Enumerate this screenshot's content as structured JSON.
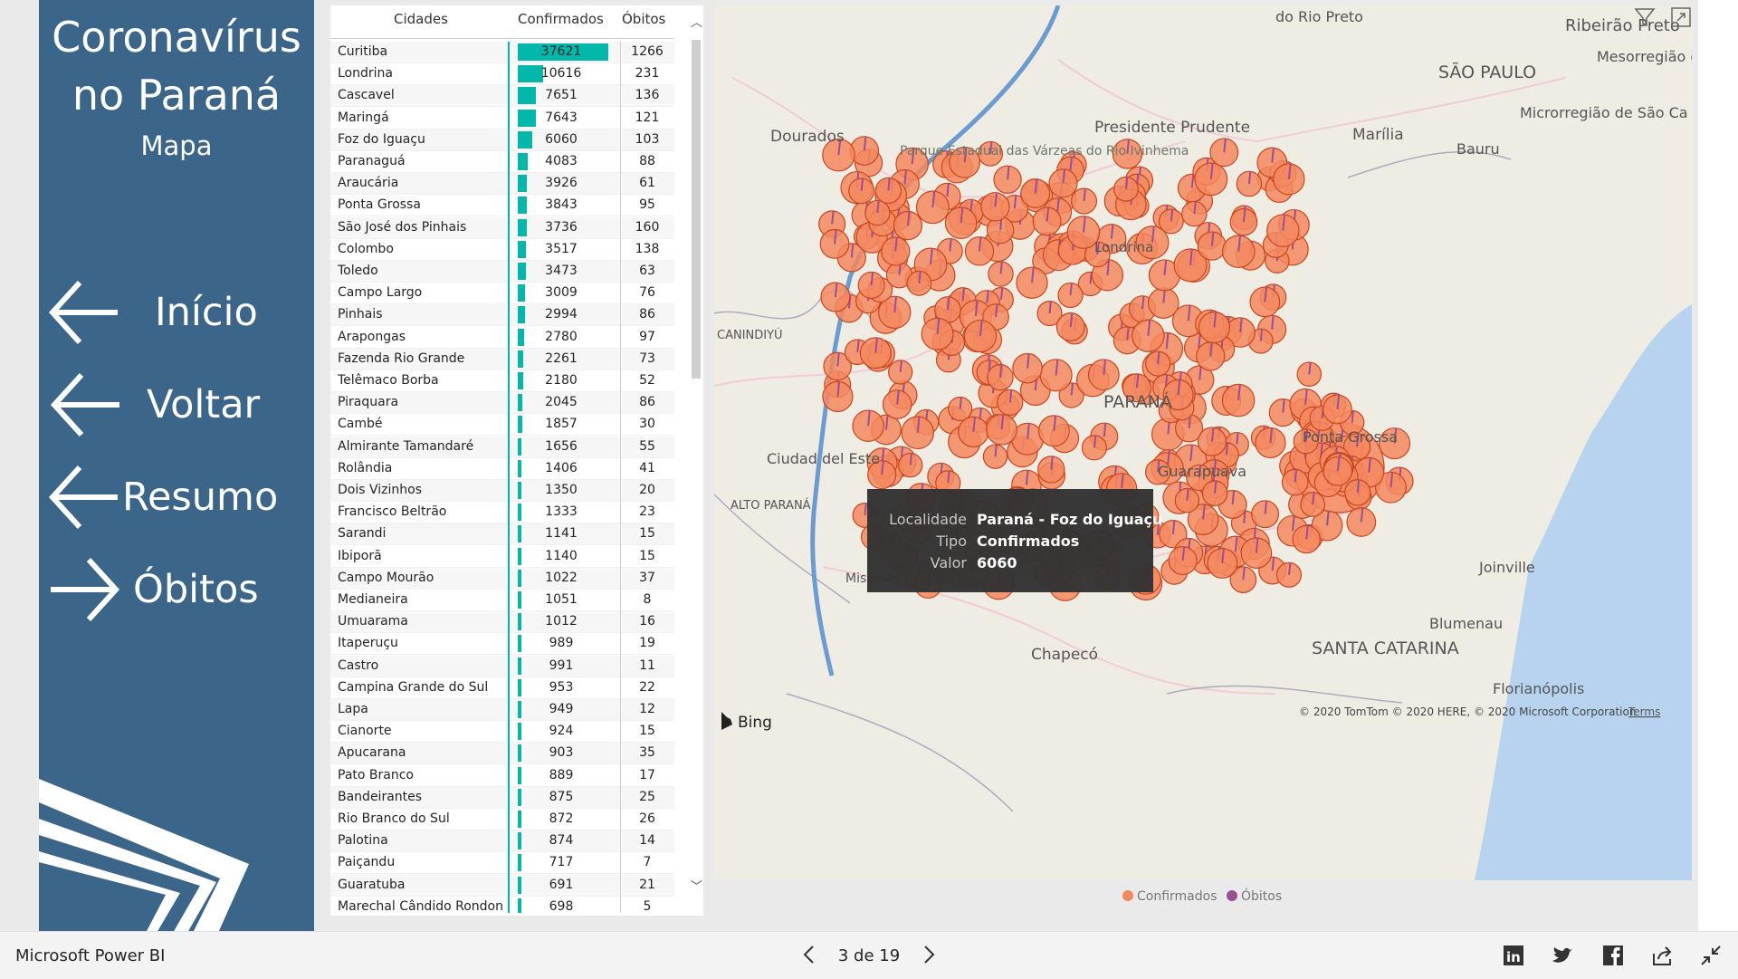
{
  "nav": {
    "title_line1": "Coronavírus",
    "title_line2": "no Paraná",
    "subtitle": "Mapa",
    "buttons": [
      {
        "label": "Início",
        "direction": "left"
      },
      {
        "label": "Voltar",
        "direction": "left"
      },
      {
        "label": "Resumo",
        "direction": "left"
      },
      {
        "label": "Óbitos",
        "direction": "right"
      }
    ]
  },
  "table": {
    "headers": {
      "city": "Cidades",
      "confirmed": "Confirmados",
      "deaths": "Óbitos"
    },
    "bar_color": "#01b8aa",
    "rows": [
      {
        "city": "Curitiba",
        "confirmed": "37621",
        "deaths": "1266"
      },
      {
        "city": "Londrina",
        "confirmed": "10616",
        "deaths": "231"
      },
      {
        "city": "Cascavel",
        "confirmed": "7651",
        "deaths": "136"
      },
      {
        "city": "Maringá",
        "confirmed": "7643",
        "deaths": "121"
      },
      {
        "city": "Foz do Iguaçu",
        "confirmed": "6060",
        "deaths": "103"
      },
      {
        "city": "Paranaguá",
        "confirmed": "4083",
        "deaths": "88"
      },
      {
        "city": "Araucária",
        "confirmed": "3926",
        "deaths": "61"
      },
      {
        "city": "Ponta Grossa",
        "confirmed": "3843",
        "deaths": "95"
      },
      {
        "city": "São José dos Pinhais",
        "confirmed": "3736",
        "deaths": "160"
      },
      {
        "city": "Colombo",
        "confirmed": "3517",
        "deaths": "138"
      },
      {
        "city": "Toledo",
        "confirmed": "3473",
        "deaths": "63"
      },
      {
        "city": "Campo Largo",
        "confirmed": "3009",
        "deaths": "76"
      },
      {
        "city": "Pinhais",
        "confirmed": "2994",
        "deaths": "86"
      },
      {
        "city": "Arapongas",
        "confirmed": "2780",
        "deaths": "97"
      },
      {
        "city": "Fazenda Rio Grande",
        "confirmed": "2261",
        "deaths": "73"
      },
      {
        "city": "Telêmaco Borba",
        "confirmed": "2180",
        "deaths": "52"
      },
      {
        "city": "Piraquara",
        "confirmed": "2045",
        "deaths": "86"
      },
      {
        "city": "Cambé",
        "confirmed": "1857",
        "deaths": "30"
      },
      {
        "city": "Almirante Tamandaré",
        "confirmed": "1656",
        "deaths": "55"
      },
      {
        "city": "Rolândia",
        "confirmed": "1406",
        "deaths": "41"
      },
      {
        "city": "Dois Vizinhos",
        "confirmed": "1350",
        "deaths": "20"
      },
      {
        "city": "Francisco Beltrão",
        "confirmed": "1333",
        "deaths": "23"
      },
      {
        "city": "Sarandi",
        "confirmed": "1141",
        "deaths": "15"
      },
      {
        "city": "Ibiporã",
        "confirmed": "1140",
        "deaths": "15"
      },
      {
        "city": "Campo Mourão",
        "confirmed": "1022",
        "deaths": "37"
      },
      {
        "city": "Medianeira",
        "confirmed": "1051",
        "deaths": "8"
      },
      {
        "city": "Umuarama",
        "confirmed": "1012",
        "deaths": "16"
      },
      {
        "city": "Itaperuçu",
        "confirmed": "989",
        "deaths": "19"
      },
      {
        "city": "Castro",
        "confirmed": "991",
        "deaths": "11"
      },
      {
        "city": "Campina Grande do Sul",
        "confirmed": "953",
        "deaths": "22"
      },
      {
        "city": "Lapa",
        "confirmed": "949",
        "deaths": "12"
      },
      {
        "city": "Cianorte",
        "confirmed": "924",
        "deaths": "15"
      },
      {
        "city": "Apucarana",
        "confirmed": "903",
        "deaths": "35"
      },
      {
        "city": "Pato Branco",
        "confirmed": "889",
        "deaths": "17"
      },
      {
        "city": "Bandeirantes",
        "confirmed": "875",
        "deaths": "25"
      },
      {
        "city": "Rio Branco do Sul",
        "confirmed": "872",
        "deaths": "26"
      },
      {
        "city": "Palotina",
        "confirmed": "874",
        "deaths": "14"
      },
      {
        "city": "Paiçandu",
        "confirmed": "717",
        "deaths": "7"
      },
      {
        "city": "Guaratuba",
        "confirmed": "691",
        "deaths": "21"
      },
      {
        "city": "Marechal Cândido Rondon",
        "confirmed": "698",
        "deaths": "5"
      }
    ]
  },
  "map": {
    "place_labels": [
      "do Rio Preto",
      "Ribeirão Preto",
      "Mesorregião de Araraquara",
      "SÃO PAULO",
      "Microrregião de São Ca",
      "Dourados",
      "Presidente Prudente",
      "Marília",
      "Bauru",
      "Parque Estadual das Várzeas do Rio Ivinhema",
      "CANINDIYÚ",
      "Londrina",
      "PARANÁ",
      "Ponta Grossa",
      "Guarapuava",
      "Ciudad del Este",
      "ALTO PARANÁ",
      "Misiones",
      "Chapecó",
      "Blumenau",
      "SANTA CATARINA",
      "Joinville",
      "Florianópolis"
    ],
    "bing_label": "Bing",
    "copyright": "© 2020 TomTom © 2020 HERE, © 2020 Microsoft Corporation",
    "terms": "Terms",
    "legend": [
      {
        "label": "Confirmados",
        "color": "#f4885f"
      },
      {
        "label": "Óbitos",
        "color": "#9b4f96"
      }
    ],
    "tooltip": {
      "k1": "Localidade",
      "v1": "Paraná - Foz do Iguaçu",
      "k2": "Tipo",
      "v2": "Confirmados",
      "k3": "Valor",
      "v3": "6060"
    }
  },
  "footer": {
    "brand": "Microsoft Power BI",
    "page_indicator": "3 de 19",
    "share_icons": [
      "linkedin-icon",
      "twitter-icon",
      "facebook-icon",
      "share-icon",
      "exit-fullscreen-icon"
    ]
  }
}
